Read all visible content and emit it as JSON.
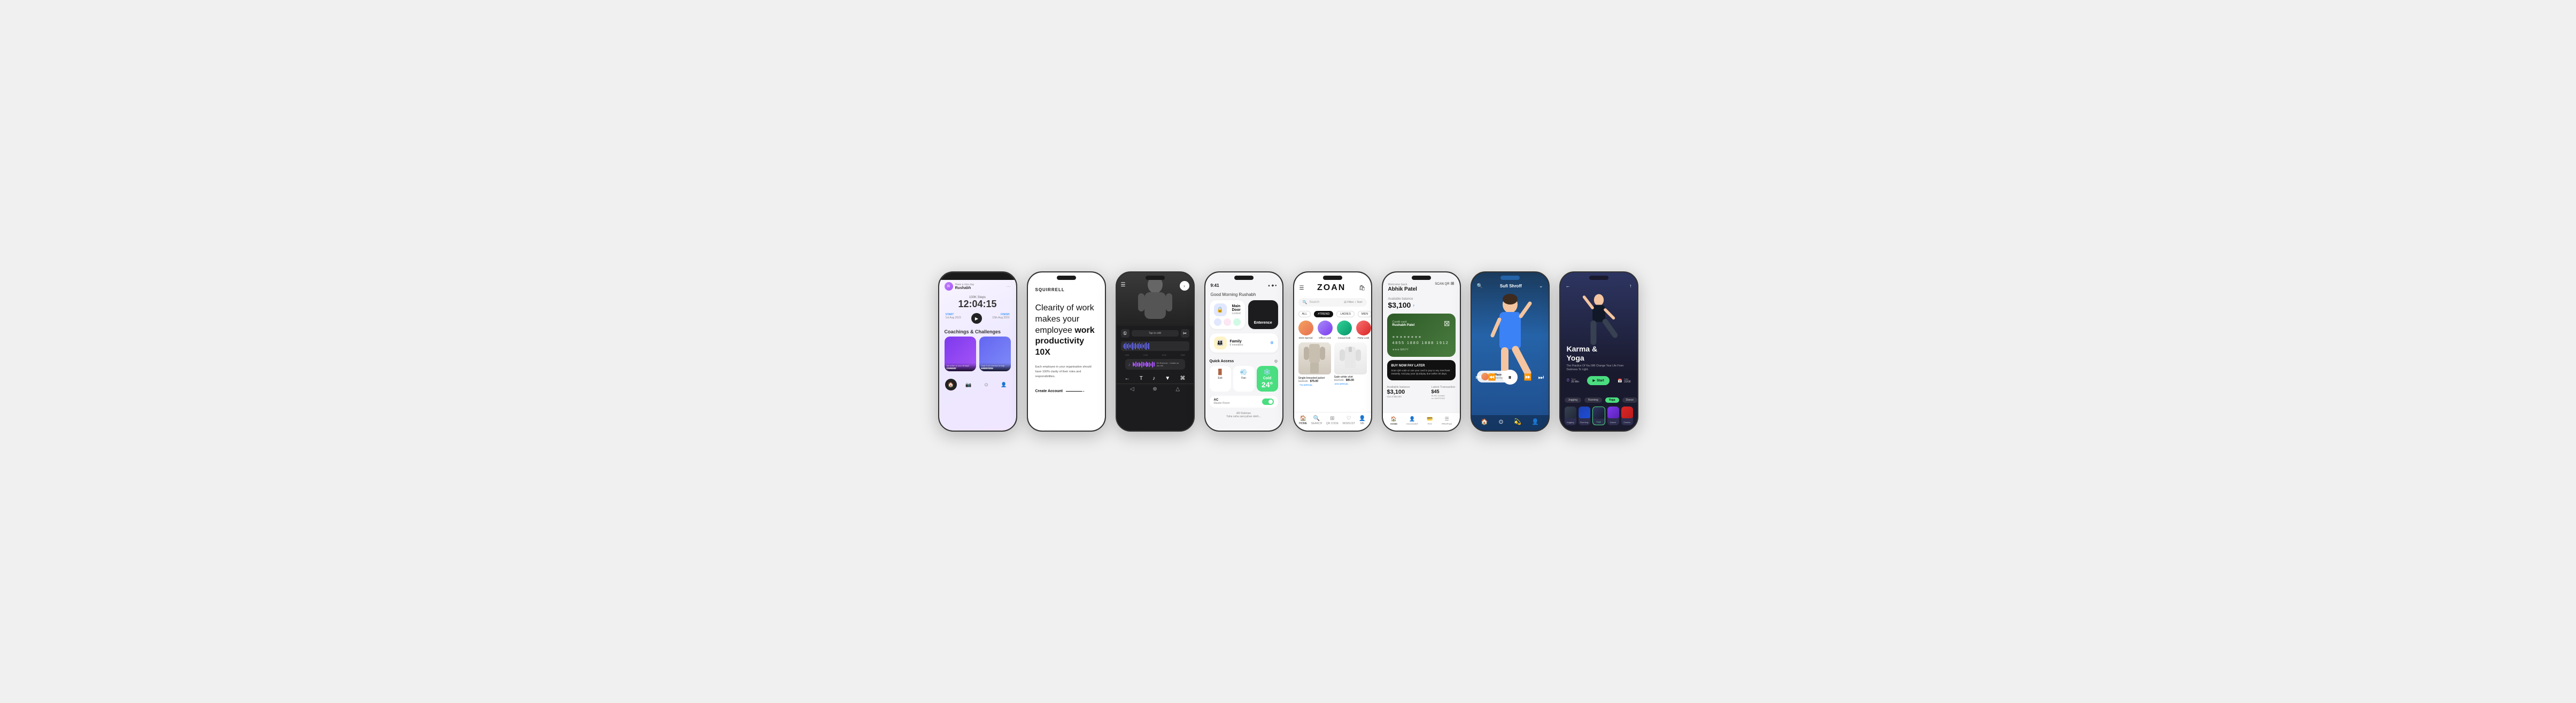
{
  "phones": [
    {
      "id": "phone1",
      "label": "Fitness Tracker",
      "user": {
        "greeting": "Have a nice day",
        "name": "Rushabh"
      },
      "steps": {
        "label": "100K Steps",
        "time": "12:04:15",
        "start_label": "START",
        "start_date": "1st Aug 2023",
        "end_label": "FINISH",
        "end_date": "15th Aug 2023"
      },
      "section_title": "Coachings & Challenges",
      "cards": [
        {
          "label": "CARDIO",
          "sub": "Get active on your off days! make a day!"
        },
        {
          "label": "EXERCISE",
          "sub": "Daily 5 min exercise for legs make a day!"
        }
      ],
      "nav_items": [
        "🏠",
        "📷",
        "⊙",
        "👤"
      ]
    },
    {
      "id": "phone2",
      "label": "Productivity App",
      "brand": "SQUIRRELL",
      "headline_part1": "Clearity of work makes your employee ",
      "headline_bold": "work productivity 10X",
      "body": "Each employee in your organisation should have 100% clarity of their roles and responsibilities.",
      "cta": "Create Account"
    },
    {
      "id": "phone3",
      "label": "Audio/Video Editor",
      "time_markers": [
        "0:00",
        "0:02",
        "0:04",
        "0:06"
      ],
      "tap_edit_label": "Tap to edit",
      "music_label": "Music",
      "track_name": "Ed Sheeran - Castle on the Hill",
      "tools": [
        "←",
        "T",
        "♪",
        "▼",
        "⌘"
      ],
      "wave_heights": [
        4,
        8,
        12,
        6,
        10,
        14,
        8,
        5,
        9,
        13,
        7,
        11,
        6,
        10,
        8,
        12,
        5,
        9,
        13,
        7
      ]
    },
    {
      "id": "phone4",
      "label": "Smart Home",
      "time": "9:41",
      "greeting": "Good Morning Rushabh",
      "rooms": [
        {
          "name": "Main Door",
          "sub": "Locked",
          "icon": "🔒",
          "color": "#e0e7ff"
        },
        {
          "name": "Enterence",
          "sub": "",
          "icon": "🏠",
          "color": "#1c1c1e",
          "dark": true
        }
      ],
      "room_groups": [
        {
          "icon": "👨‍👩‍👧",
          "name": "Family",
          "sub": "6 members",
          "color": "#fef3c7"
        }
      ],
      "quick_access_title": "Quick Access",
      "controls": [
        {
          "label": "Exit",
          "icon": "🚪"
        },
        {
          "label": "Fan",
          "icon": "💨"
        },
        {
          "label": "Cold",
          "icon": "❄️",
          "active": true
        }
      ],
      "temperature": "24°",
      "ac_name": "AC",
      "ac_room": "Master Room",
      "footer_text": "AR Rahman\nYaha vaha sara jahan dekh..."
    },
    {
      "id": "phone5",
      "label": "Fashion Shopping",
      "brand": "ZOAN",
      "filters": [
        "ALL",
        "#TREND",
        "LADIES",
        "MEN",
        "BABY"
      ],
      "active_filter": "#TREND",
      "categories": [
        {
          "label": "2023 Special",
          "color": "#f4a261"
        },
        {
          "label": "Office Look",
          "color": "#a78bfa"
        },
        {
          "label": "Casual look",
          "color": "#34d399"
        },
        {
          "label": "Party Look",
          "color": "#f87171"
        }
      ],
      "products": [
        {
          "name": "Single-breasted jacket",
          "price_old": "$129.95",
          "price_new": "$75.00",
          "tag": "NEW ARRIVAL",
          "bg": "#e8e0d8"
        },
        {
          "name": "Satin white shirt",
          "price_old": "$124.99",
          "price_new": "$85.00",
          "tag": "NEW ARRIVAL",
          "bg": "#f0f0f0"
        }
      ],
      "nav": [
        "HOME",
        "SEARCH",
        "QR CODE",
        "WISHLIST",
        "ME"
      ]
    },
    {
      "id": "phone6",
      "label": "Banking App",
      "welcome": "Welcome back",
      "user_name": "Abhik Patel",
      "scan_qr": "SCAN QR",
      "available_balance_label": "Available balance",
      "balance": "$3,100",
      "card": {
        "type": "Credit card",
        "holder": "Rushabh Patel",
        "number": "4855  1880  1888  1912",
        "stars": "★★★  MA/YY"
      },
      "quick_pay_label": "Quick Pay",
      "bnpl_title": "BUY NOW PAY LATER",
      "bnpl_desc": "Scan QR code or use your card to pay to any merchant instantly. And pay your Quickpay due within 30 days.",
      "balance_bottom": "$3,100",
      "out_of": "Out of $6,000",
      "latest_transaction_label": "Latest Transaction",
      "transaction_amount": "$45",
      "transaction_merchant": "At MC Donald",
      "transaction_date": "on 16/07/2022",
      "nav": [
        "HOME",
        "ACCOUNT",
        "PAY",
        "PROFILE"
      ]
    },
    {
      "id": "phone7",
      "label": "Fashion App",
      "user_name": "Sufi Shroff",
      "location_name": "My Place",
      "location_sub": "Around the world"
    },
    {
      "id": "phone8",
      "label": "Yoga App",
      "title": "Karma &\nYoga",
      "subtitle": "The Practice Of You Will Change Your Life From Darkness To Light.",
      "meta": [
        {
          "icon": "⏱",
          "label": "Time",
          "value": "35 Min"
        },
        {
          "icon": "▶",
          "label": "Start",
          "active": true
        },
        {
          "icon": "📅",
          "label": "Date",
          "value": "20/08"
        }
      ],
      "categories": [
        "Jogging",
        "Running",
        "Yoga",
        "Dance",
        "Zumba"
      ],
      "active_category": "Yoga",
      "thumbs": [
        "Jogging",
        "Running",
        "Yoga",
        "Dance",
        "Zumba"
      ]
    }
  ]
}
